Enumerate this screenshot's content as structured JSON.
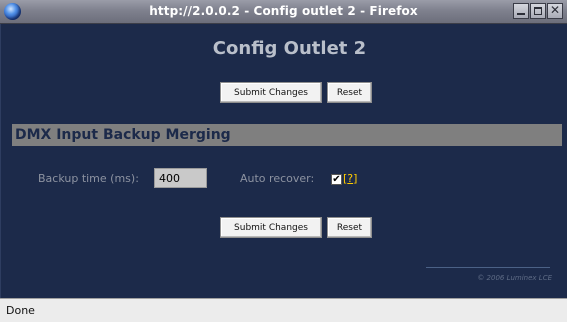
{
  "window": {
    "title": "http://2.0.0.2 - Config outlet 2 - Firefox",
    "controls": {
      "minimize": "minimize",
      "maximize": "maximize",
      "close": "✕"
    }
  },
  "page": {
    "title": "Config Outlet 2",
    "buttons": {
      "submit_label": "Submit Changes",
      "reset_label": "Reset"
    },
    "section": {
      "header": "DMX Input Backup Merging",
      "backup_time_label": "Backup time (ms):",
      "backup_time_value": "400",
      "auto_recover_label": "Auto recover:",
      "auto_recover_checked": true,
      "help_open": "[",
      "help_q": "?",
      "help_close": "]"
    },
    "copyright": "© 2006 Luminex LCE"
  },
  "statusbar": {
    "text": "Done"
  },
  "colors": {
    "background": "#1c2a4a",
    "section_header": "#7f7f7f",
    "help_link": "#ffcc00"
  }
}
